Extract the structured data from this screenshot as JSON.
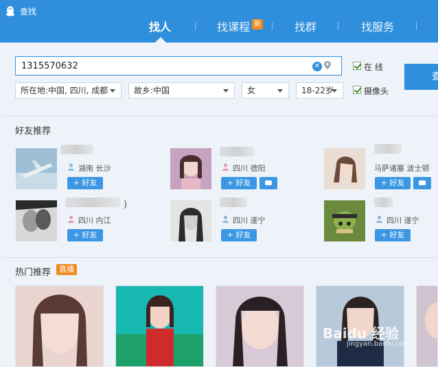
{
  "window": {
    "title": "查找"
  },
  "tabs": [
    {
      "label": "找人",
      "active": true
    },
    {
      "label": "找课程",
      "badge": "新"
    },
    {
      "label": "找群"
    },
    {
      "label": "找服务"
    }
  ],
  "search": {
    "value": "1315570632",
    "online_label": "在 线",
    "camera_label": "摄像头",
    "button_label": "查",
    "location": "所在地:中国, 四川, 成都",
    "hometown": "故乡:中国",
    "gender": "女",
    "age": "18-22岁"
  },
  "friends": {
    "title": "好友推荐",
    "add_label": "+ 好友",
    "items": [
      {
        "place": "湖南 长沙"
      },
      {
        "place": "四川 德阳"
      },
      {
        "place": "马萨诸塞 波士顿"
      },
      {
        "place": "四川 内江",
        "name_suffix": ")"
      },
      {
        "place": "四川 遂宁"
      },
      {
        "place": "四川 遂宁"
      }
    ]
  },
  "hot": {
    "title": "热门推荐",
    "badge": "直播"
  },
  "watermark": {
    "main": "Baidu 经验",
    "sub": "jingyan.baidu.com"
  },
  "colors": {
    "accent": "#2f8fdc",
    "badge": "#f08a1d"
  }
}
